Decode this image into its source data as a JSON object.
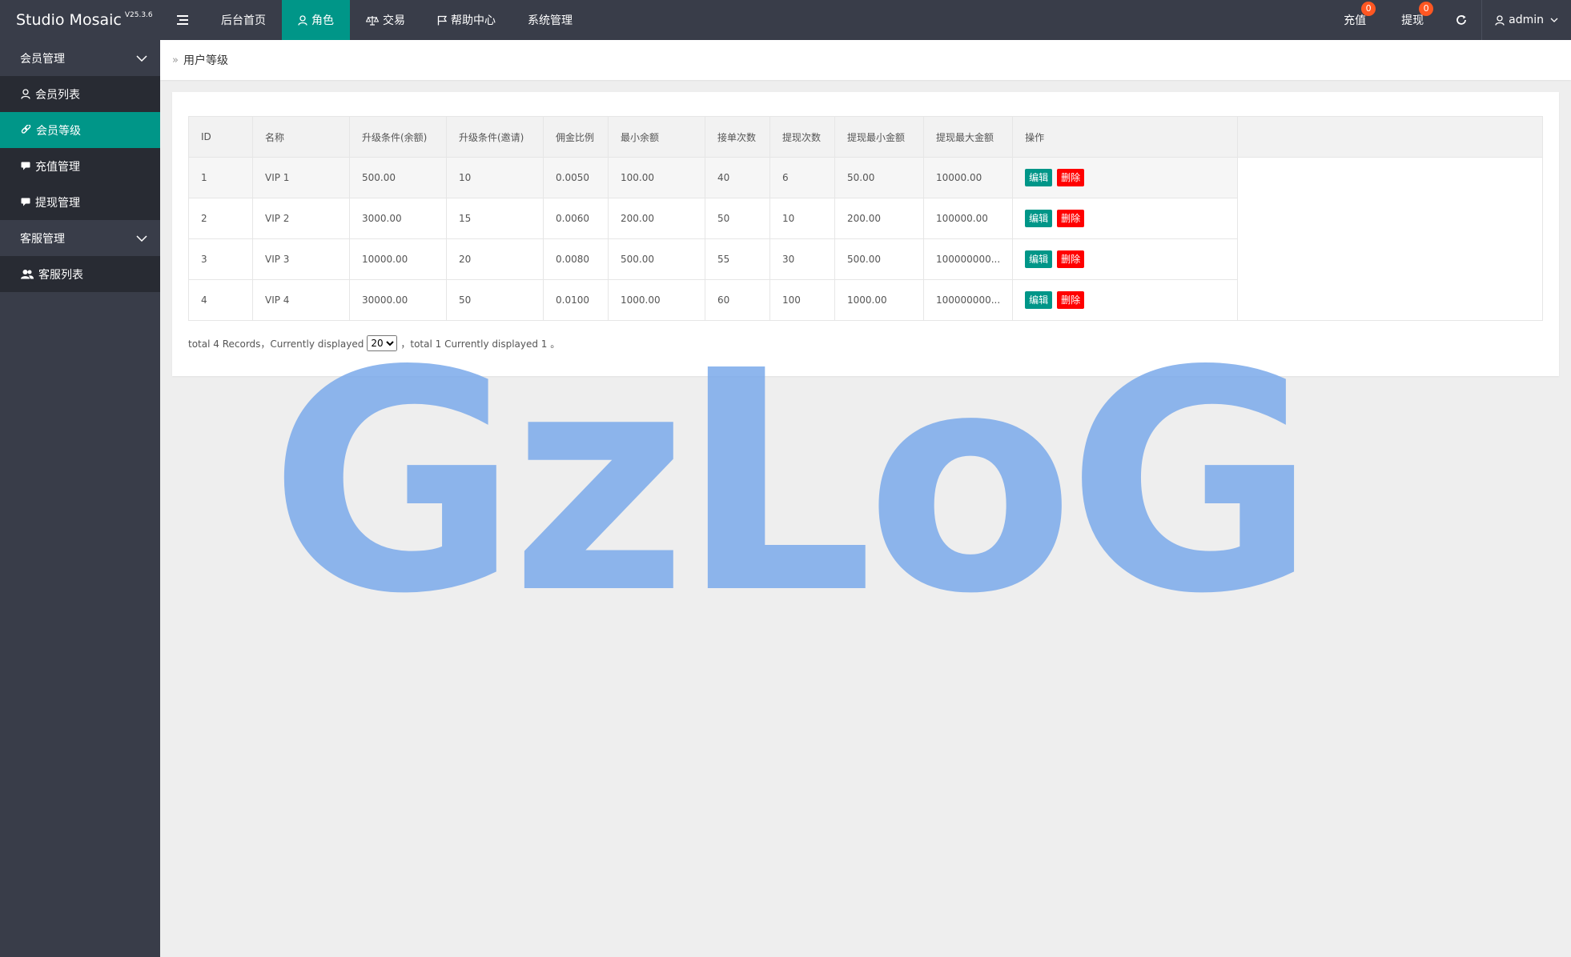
{
  "brand": {
    "name": "Studio Mosaic",
    "version": "V25.3.6"
  },
  "topnav": {
    "items": [
      {
        "label": "后台首页",
        "icon": "none",
        "active": false
      },
      {
        "label": "角色",
        "icon": "user-icon",
        "active": true
      },
      {
        "label": "交易",
        "icon": "scale-icon",
        "active": false
      },
      {
        "label": "帮助中心",
        "icon": "flag-icon",
        "active": false
      },
      {
        "label": "系统管理",
        "icon": "none",
        "active": false
      }
    ],
    "recharge": {
      "label": "充值",
      "badge": "0"
    },
    "withdraw": {
      "label": "提现",
      "badge": "0"
    },
    "user": {
      "label": "admin"
    }
  },
  "sidebar": {
    "groups": [
      {
        "label": "会员管理",
        "items": [
          "会员列表",
          "会员等级",
          "充值管理",
          "提现管理"
        ]
      },
      {
        "label": "客服管理",
        "items": [
          "客服列表"
        ]
      }
    ],
    "active_item": "会员等级"
  },
  "breadcrumb": {
    "current": "用户等级"
  },
  "table": {
    "headers": [
      "ID",
      "名称",
      "升级条件(余额)",
      "升级条件(邀请)",
      "佣金比例",
      "最小余额",
      "接单次数",
      "提现次数",
      "提现最小金额",
      "提现最大金额",
      "操作"
    ],
    "rows": [
      [
        "1",
        "VIP 1",
        "500.00",
        "10",
        "0.0050",
        "100.00",
        "40",
        "6",
        "50.00",
        "10000.00"
      ],
      [
        "2",
        "VIP 2",
        "3000.00",
        "15",
        "0.0060",
        "200.00",
        "50",
        "10",
        "200.00",
        "100000.00"
      ],
      [
        "3",
        "VIP 3",
        "10000.00",
        "20",
        "0.0080",
        "500.00",
        "55",
        "30",
        "500.00",
        "100000000..."
      ],
      [
        "4",
        "VIP 4",
        "30000.00",
        "50",
        "0.0100",
        "1000.00",
        "60",
        "100",
        "1000.00",
        "100000000..."
      ]
    ],
    "edit_label": "编辑",
    "delete_label": "删除"
  },
  "pager": {
    "prefix": "total 4 Records，Currently displayed",
    "page_size": "20",
    "suffix": "，total 1 Currently displayed 1 。"
  },
  "watermark": {
    "text": "GzLoG",
    "color": "#7aa9ea"
  },
  "colors": {
    "topbar": "#393d49",
    "accent": "#009688",
    "danger": "#ff0000",
    "badge": "#ff5722"
  }
}
